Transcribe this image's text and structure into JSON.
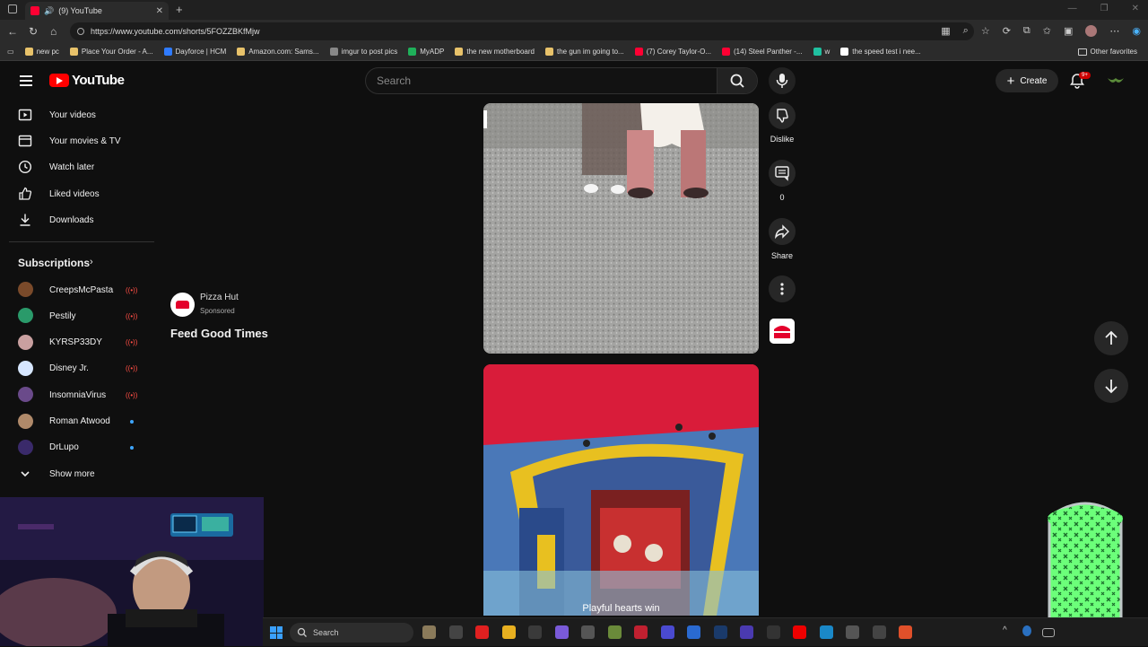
{
  "browser": {
    "tab_title": "(9) YouTube",
    "url": "https://www.youtube.com/shorts/5FOZZBKfMjw",
    "bookmarks": [
      {
        "label": "new pc",
        "color": "#e8c26a"
      },
      {
        "label": "Place Your Order - A...",
        "color": "#e8c26a"
      },
      {
        "label": "Dayforce | HCM",
        "color": "#2f7bff"
      },
      {
        "label": "Amazon.com: Sams...",
        "color": "#e8c26a"
      },
      {
        "label": "imgur to post pics",
        "color": "#888888"
      },
      {
        "label": "MyADP",
        "color": "#1fb05a"
      },
      {
        "label": "the new motherboard",
        "color": "#e8c26a"
      },
      {
        "label": "the gun im going to...",
        "color": "#e8c26a"
      },
      {
        "label": "(7) Corey Taylor-O...",
        "color": "#ff0033"
      },
      {
        "label": "(14) Steel Panther -...",
        "color": "#ff0033"
      },
      {
        "label": "w",
        "color": "#20c0a0"
      },
      {
        "label": "the speed test i nee...",
        "color": "#ffffff"
      }
    ],
    "other_favorites": "Other favorites"
  },
  "header": {
    "logo_text": "YouTube",
    "search_placeholder": "Search",
    "create_label": "Create",
    "notification_badge": "9+"
  },
  "sidebar": {
    "items": [
      {
        "label": "Your videos",
        "icon": "play-square-icon"
      },
      {
        "label": "Your movies & TV",
        "icon": "film-icon"
      },
      {
        "label": "Watch later",
        "icon": "clock-icon"
      },
      {
        "label": "Liked videos",
        "icon": "thumbs-up-icon"
      },
      {
        "label": "Downloads",
        "icon": "download-icon"
      }
    ],
    "subscriptions_title": "Subscriptions",
    "subscriptions": [
      {
        "label": "CreepsMcPasta",
        "status": "live",
        "color": "#7a4a2a"
      },
      {
        "label": "Pestily",
        "status": "live",
        "color": "#2a9a6a"
      },
      {
        "label": "KYRSP33DY",
        "status": "live",
        "color": "#c9a0a0"
      },
      {
        "label": "Disney Jr.",
        "status": "live",
        "color": "#d6e6ff"
      },
      {
        "label": "InsomniaVirus",
        "status": "live",
        "color": "#6a4a8a"
      },
      {
        "label": "Roman Atwood",
        "status": "new",
        "color": "#b08a6a"
      },
      {
        "label": "DrLupo",
        "status": "new",
        "color": "#3a2a6a"
      }
    ],
    "show_more": "Show more"
  },
  "ad": {
    "advertiser": "Pizza Hut",
    "sponsored": "Sponsored",
    "headline": "Feed Good Times"
  },
  "actions": {
    "dislike_label": "Dislike",
    "comments_count": "0",
    "share_label": "Share"
  },
  "video2": {
    "caption": "Playful hearts win"
  },
  "taskbar": {
    "search_label": "Search"
  }
}
